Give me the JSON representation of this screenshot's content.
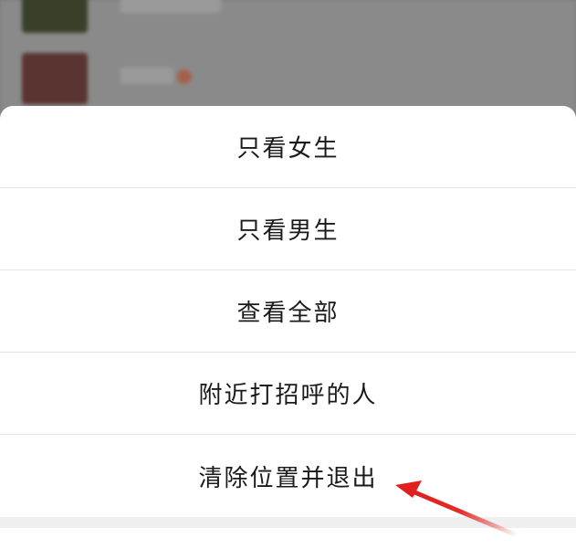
{
  "action_sheet": {
    "items": [
      {
        "label": "只看女生"
      },
      {
        "label": "只看男生"
      },
      {
        "label": "查看全部"
      },
      {
        "label": "附近打招呼的人"
      },
      {
        "label": "清除位置并退出"
      }
    ]
  },
  "colors": {
    "overlay": "#7c7c7c",
    "sheet_background": "#ffffff",
    "divider": "#e4e4e4",
    "text": "#1a1a1a",
    "annotation_arrow": "#e0201c"
  },
  "annotation": {
    "icon": "red-arrow-icon",
    "points_to": "清除位置并退出"
  }
}
